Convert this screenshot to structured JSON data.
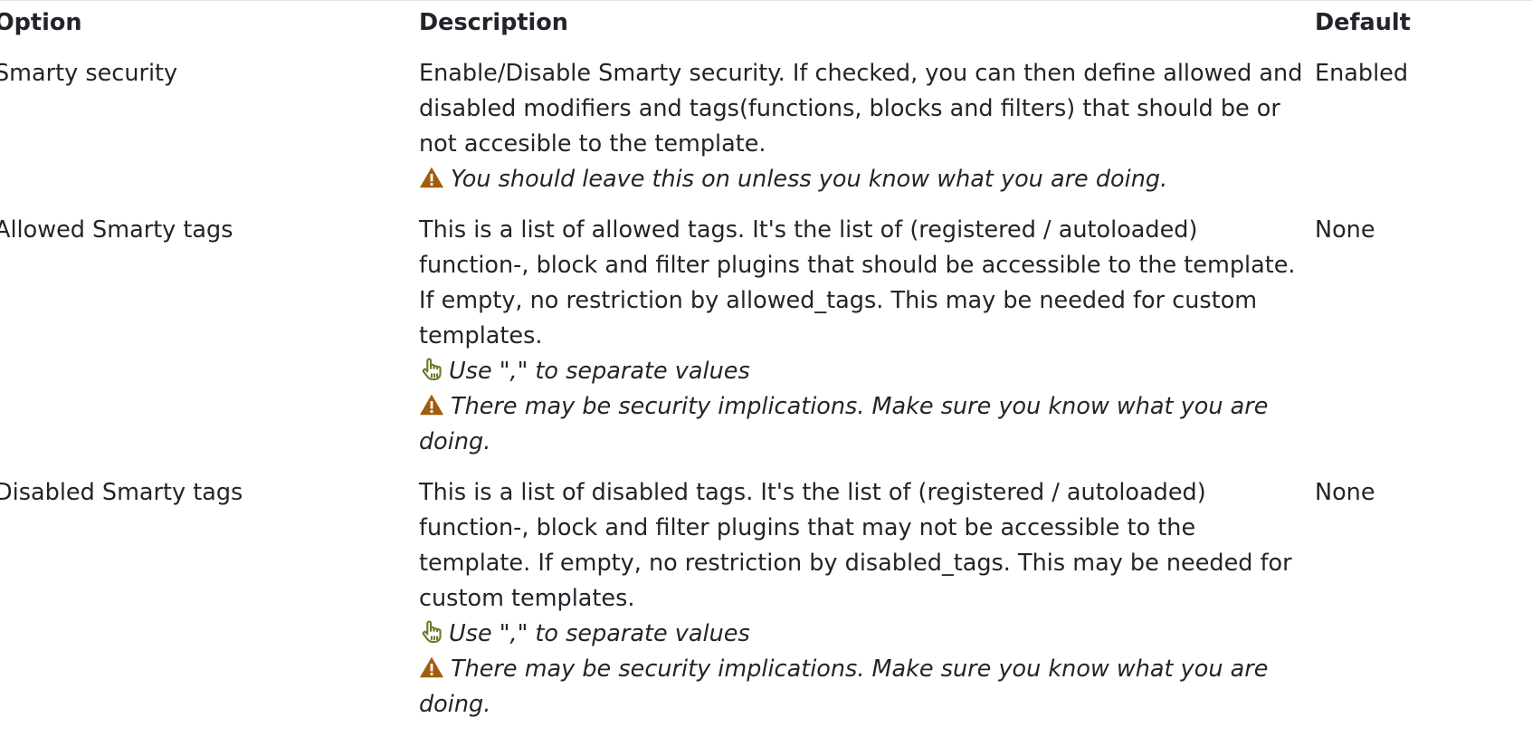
{
  "table": {
    "headers": {
      "option": "Option",
      "description": "Description",
      "default": "Default"
    },
    "rows": [
      {
        "option": "Smarty security",
        "description": "Enable/Disable Smarty security. If checked, you can then define allowed and disabled modifiers and tags(functions, blocks and filters) that should be or not accesible to the template.",
        "warning": "You should leave this on unless you know what you are doing.",
        "default": "Enabled"
      },
      {
        "option": "Allowed Smarty tags",
        "description": "This is a list of allowed tags. It's the list of (registered / autoloaded) function-, block and filter plugins that should be accessible to the template. If empty, no restriction by allowed_tags. This may be needed for custom templates.",
        "tip": "Use \",\" to separate values",
        "warning": "There may be security implications. Make sure you know what you are doing.",
        "default": "None"
      },
      {
        "option": "Disabled Smarty tags",
        "description": "This is a list of disabled tags. It's the list of (registered / autoloaded) function-, block and filter plugins that may not be accessible to the template. If empty, no restriction by disabled_tags. This may be needed for custom templates.",
        "tip": "Use \",\" to separate values",
        "warning": "There may be security implications. Make sure you know what you are doing.",
        "default": "None"
      }
    ]
  },
  "icons": {
    "warning": "warning-triangle-icon",
    "tip": "pointing-hand-icon"
  },
  "colors": {
    "text": "#212529",
    "warning_icon": "#a35b0f",
    "tip_icon": "#6b7a2a"
  }
}
